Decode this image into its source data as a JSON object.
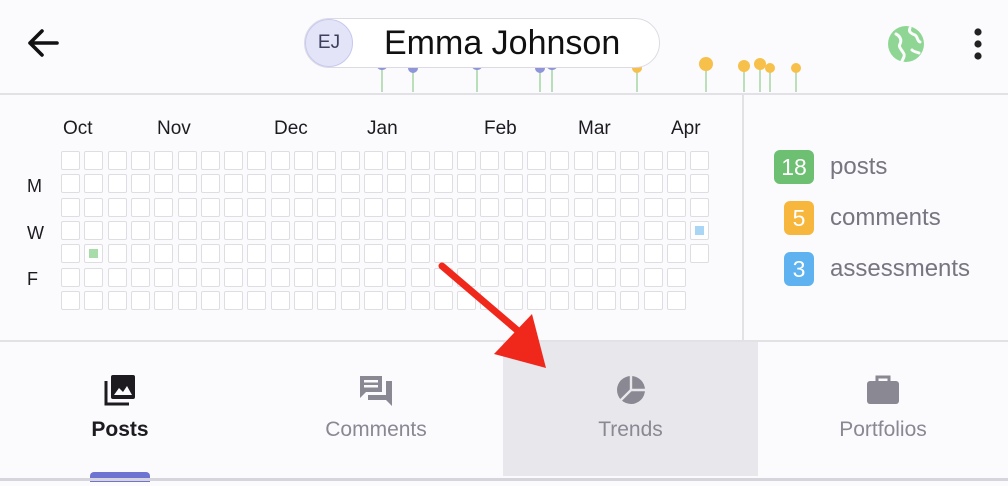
{
  "header": {
    "avatar_initials": "EJ",
    "user_name": "Emma Johnson"
  },
  "heatmap": {
    "months": [
      "Oct",
      "Nov",
      "Dec",
      "Jan",
      "Feb",
      "Mar",
      "Apr"
    ],
    "day_labels": [
      "M",
      "W",
      "F"
    ],
    "active_colors": {
      "post": "#a8dcab",
      "assessment": "#a9d6f5"
    }
  },
  "stats": [
    {
      "count": "18",
      "label": "posts",
      "color": "#6dbf72"
    },
    {
      "count": "5",
      "label": "comments",
      "color": "#f6b73c"
    },
    {
      "count": "3",
      "label": "assessments",
      "color": "#5eb2ef"
    }
  ],
  "tabs": [
    {
      "label": "Posts",
      "icon": "photo-library-icon",
      "state": "selected"
    },
    {
      "label": "Comments",
      "icon": "forum-icon",
      "state": "default"
    },
    {
      "label": "Trends",
      "icon": "pie-chart-icon",
      "state": "highlighted"
    },
    {
      "label": "Portfolios",
      "icon": "briefcase-icon",
      "state": "default"
    }
  ],
  "colors": {
    "accent": "#6f73d2",
    "annotation_arrow": "#f0281c",
    "globe": "#8fd694"
  }
}
